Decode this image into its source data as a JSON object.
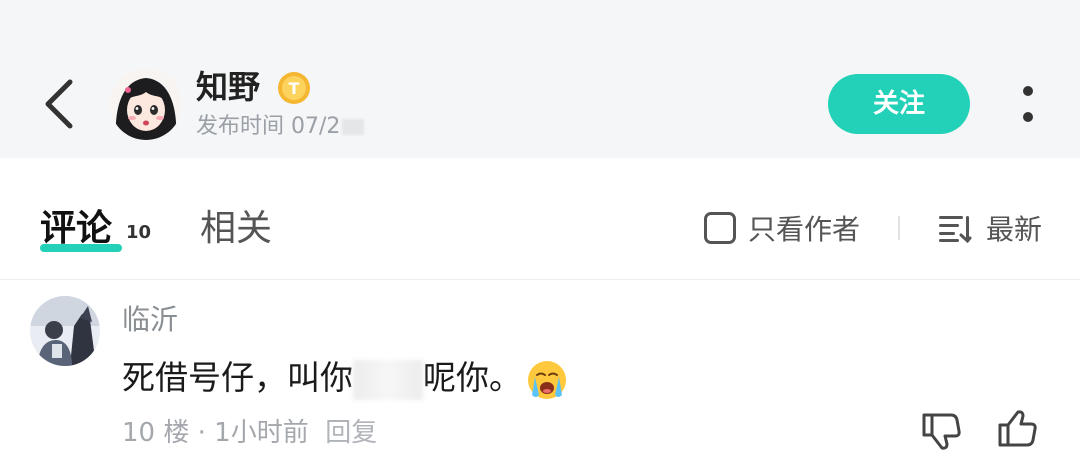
{
  "header": {
    "back_icon": "chevron-left-icon",
    "author_name": "知野",
    "level_badge_letter": "T",
    "publish_time": "发布时间 07/2",
    "follow_label": "关注",
    "more_icon": "more-vertical-icon",
    "accent_color": "#22d1b8"
  },
  "tabs": {
    "comments_label": "评论",
    "comments_count": "10",
    "related_label": "相关",
    "author_only_label": "只看作者",
    "sort_label": "最新"
  },
  "comment": {
    "user_name": "临沂",
    "text_before": "死借号仔，叫你",
    "text_after": "呢你。",
    "emoji": "crying-face-emoji",
    "floor": "10 楼",
    "separator": "·",
    "time": "1小时前",
    "reply_label": "回复"
  }
}
